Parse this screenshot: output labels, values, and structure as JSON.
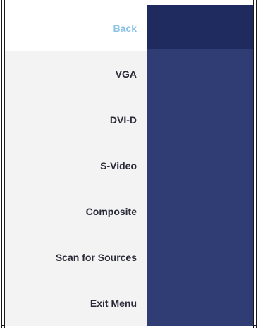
{
  "menu": {
    "items": [
      {
        "label": "Back",
        "state": "selected"
      },
      {
        "label": "VGA"
      },
      {
        "label": "DVI-D"
      },
      {
        "label": "S-Video"
      },
      {
        "label": "Composite"
      },
      {
        "label": "Scan for Sources"
      },
      {
        "label": "Exit Menu"
      }
    ]
  },
  "colors": {
    "menu_background": "#f3f3f4",
    "selected_item_background": "#ffffff",
    "selected_item_text": "#8cc3e6",
    "item_text": "#2b2b38",
    "panel_background": "#2f3d74",
    "panel_header": "#1f2b5f"
  }
}
